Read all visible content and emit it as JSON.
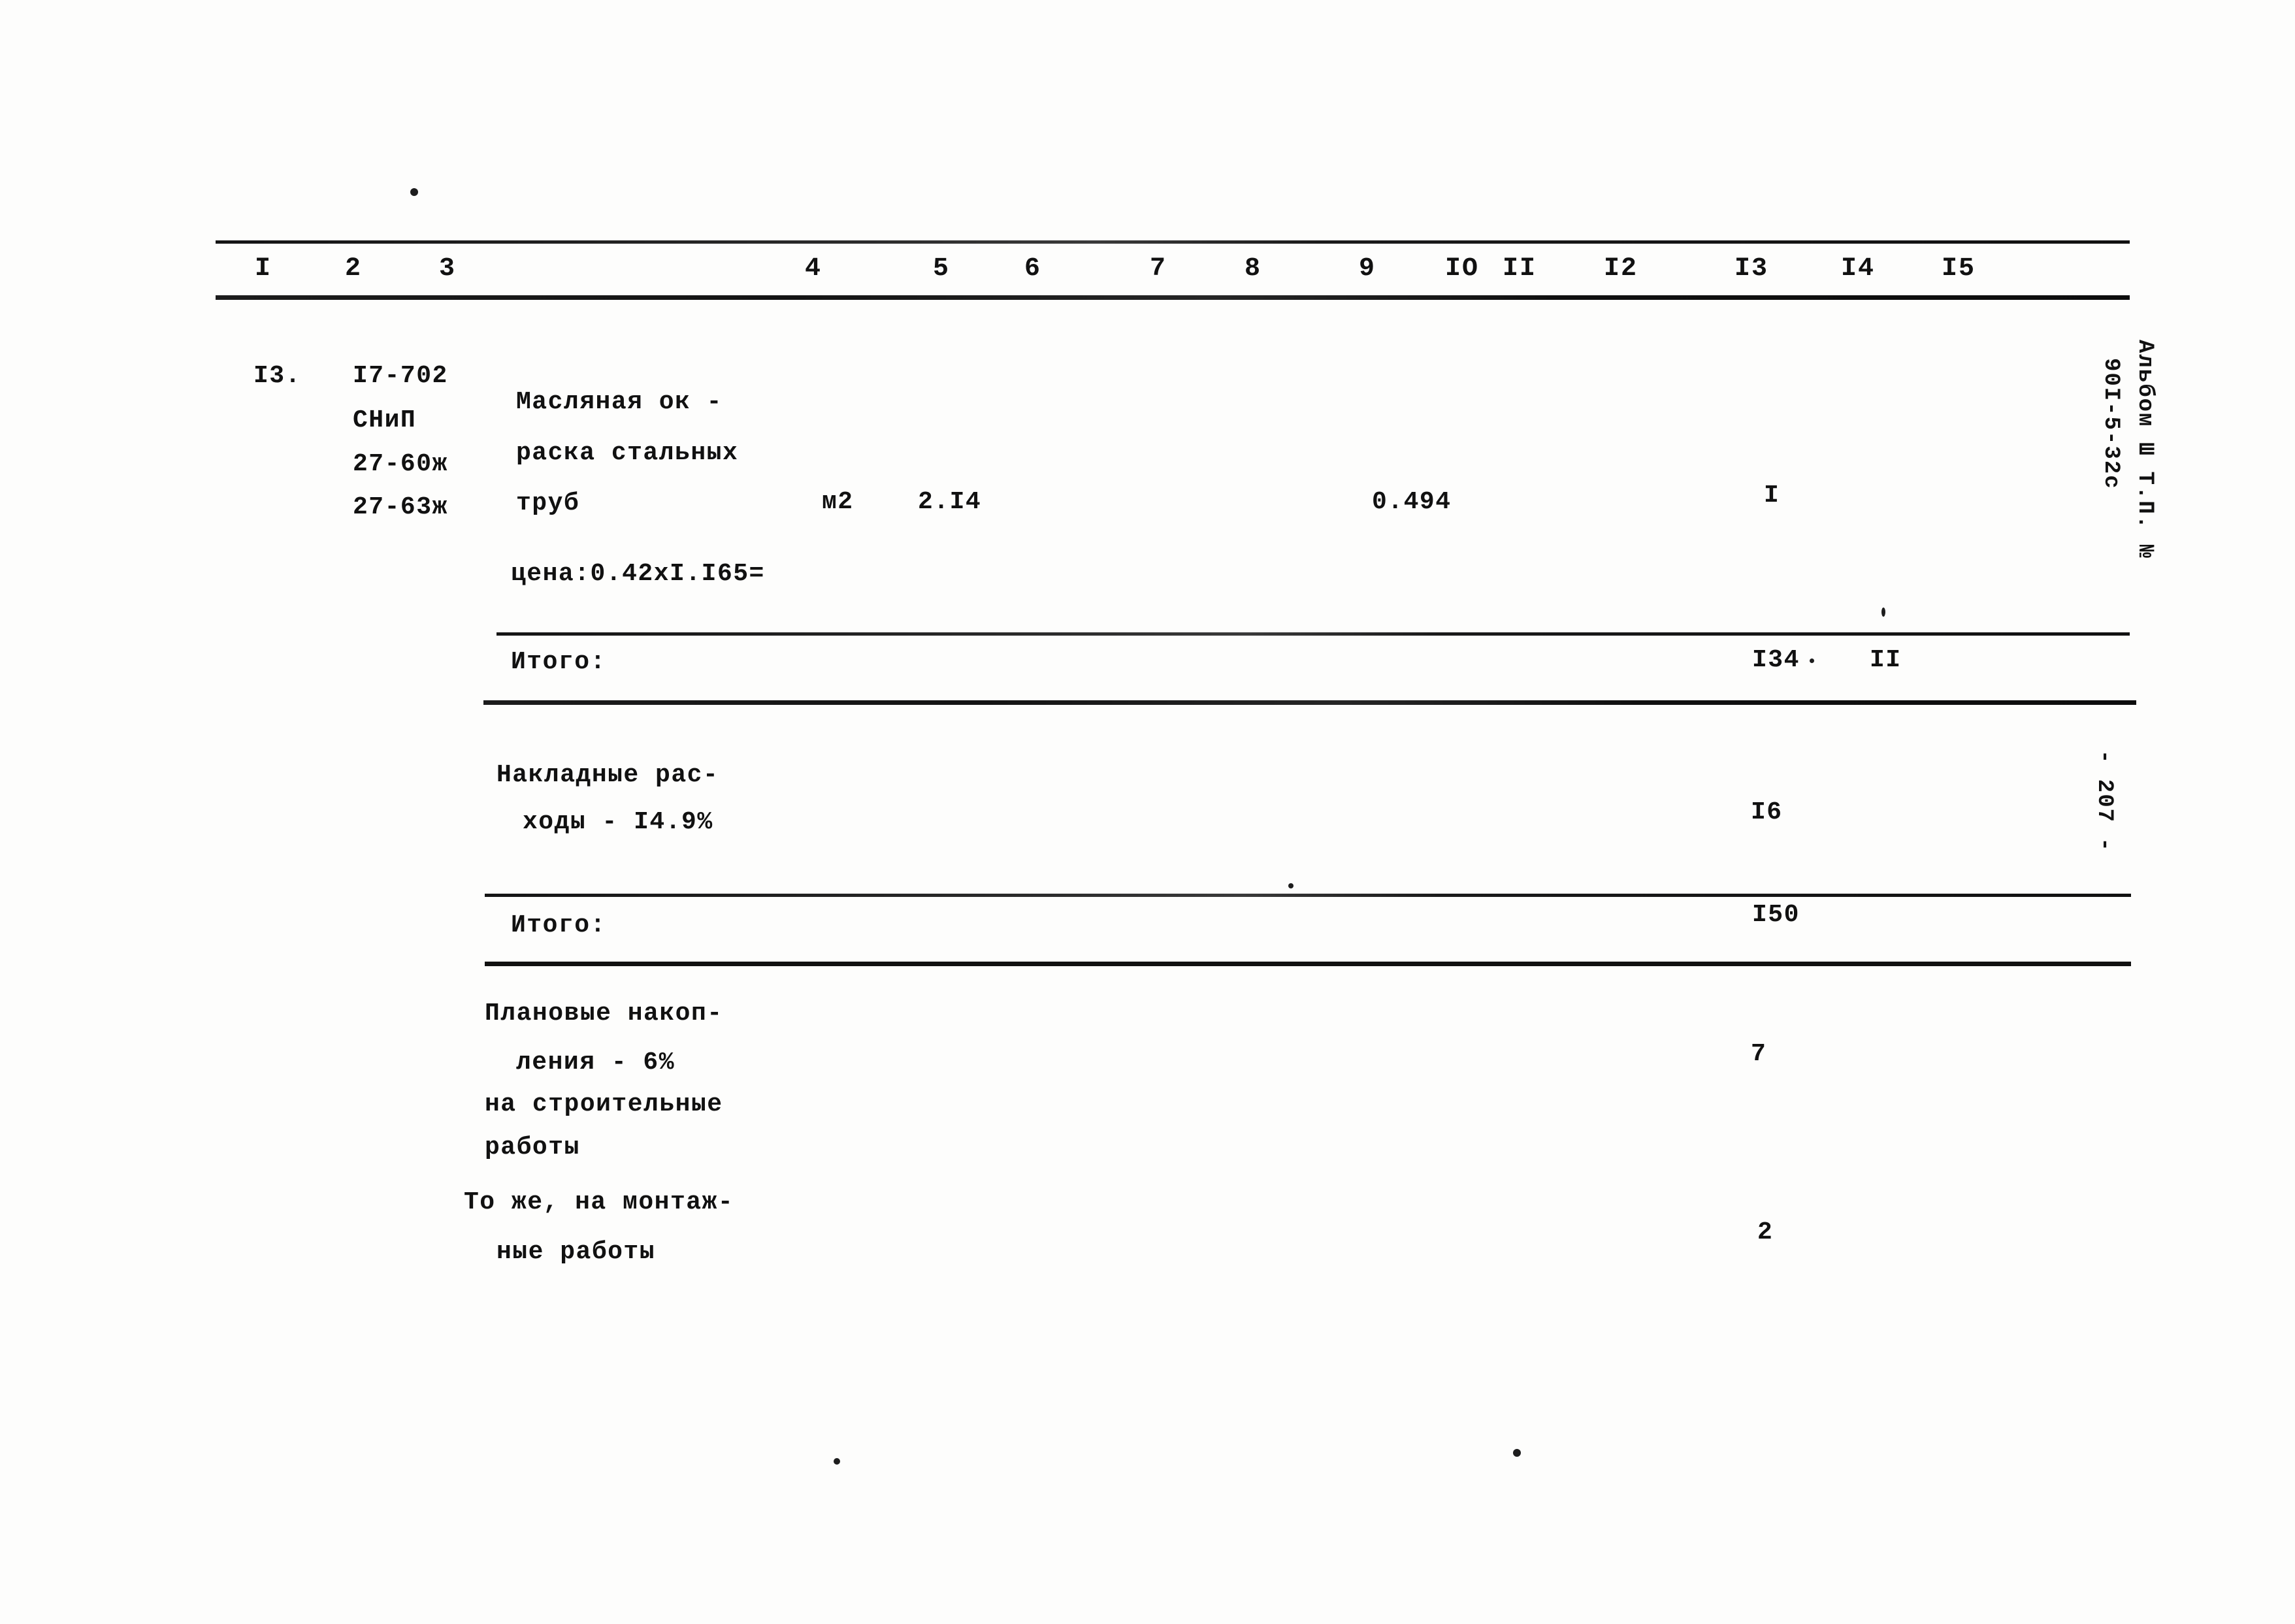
{
  "document": {
    "album_label": "Альбом Ш Т.П. №",
    "album_number": "90I-5-32с",
    "page_marker": "- 207 -"
  },
  "table": {
    "column_headers": [
      "I",
      "2",
      "3",
      "4",
      "5",
      "6",
      "7",
      "8",
      "9",
      "IO",
      "II",
      "I2",
      "I3",
      "I4",
      "I5"
    ],
    "rows": [
      {
        "item_no": "I3.",
        "codes": [
          "I7-702",
          "СНиП",
          "27-60ж",
          "27-63ж"
        ],
        "description": [
          "Масляная ок -",
          "раска стальных",
          "труб"
        ],
        "unit": "м2",
        "quantity": "2.I4",
        "rate": "0.494",
        "col13": "I",
        "note": "цена:0.42хI.I65="
      }
    ],
    "summaries": [
      {
        "label": "Итого:",
        "col13": "I34",
        "col14": "II"
      },
      {
        "label": [
          "Накладные рас-",
          "ходы - I4.9%"
        ],
        "col13": "I6"
      },
      {
        "label": "Итого:",
        "col13": "I50"
      },
      {
        "label": [
          "Плановые накоп-",
          "ления - 6%",
          "на строительные",
          "работы"
        ],
        "col13": "7"
      },
      {
        "label": [
          "То же, на монтаж-",
          "ные работы"
        ],
        "col13": "2"
      }
    ]
  }
}
